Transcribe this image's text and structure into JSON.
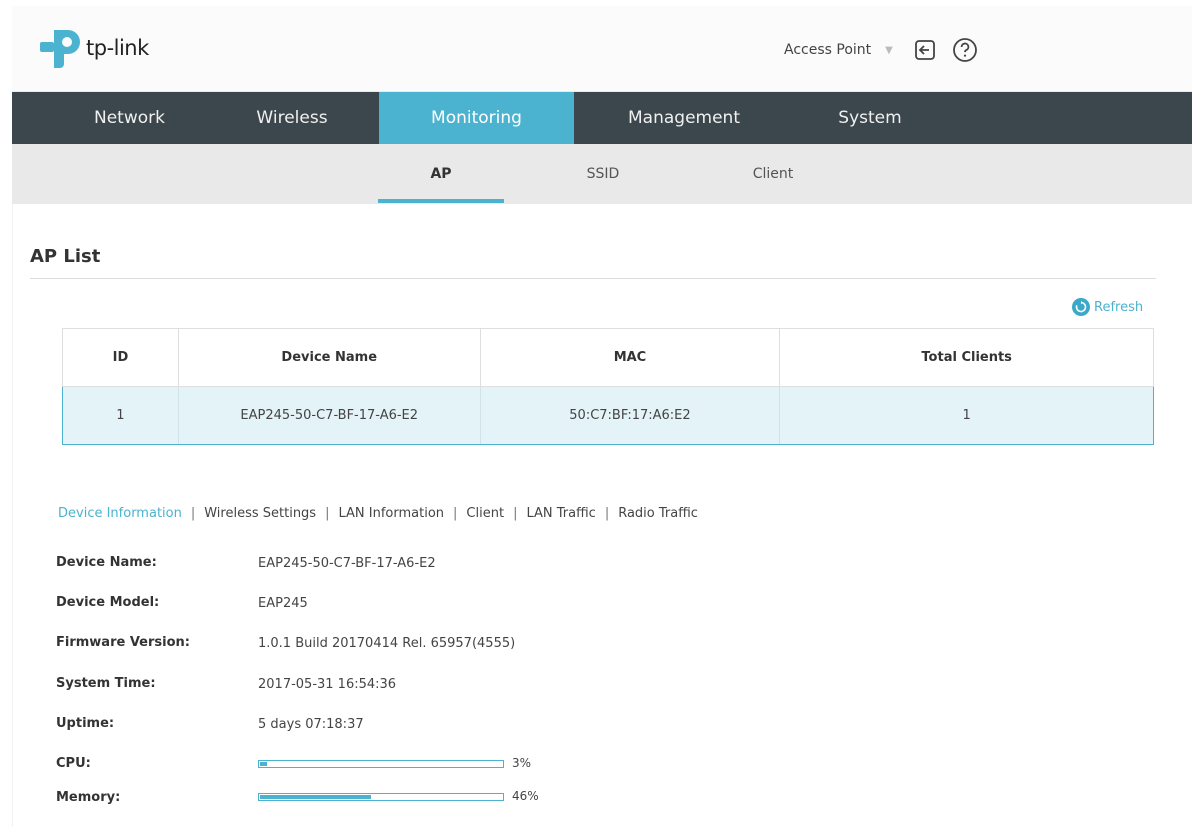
{
  "brand": {
    "name": "tp-link",
    "primary": "#4bb3cf",
    "nav_bg": "#3b474d"
  },
  "header": {
    "mode": "Access Point",
    "logout_icon": "logout-icon",
    "help_icon": "help-icon"
  },
  "main_nav": [
    {
      "label": "Network",
      "active": false
    },
    {
      "label": "Wireless",
      "active": false
    },
    {
      "label": "Monitoring",
      "active": true
    },
    {
      "label": "Management",
      "active": false
    },
    {
      "label": "System",
      "active": false
    }
  ],
  "sub_nav": [
    {
      "label": "AP",
      "active": true
    },
    {
      "label": "SSID",
      "active": false
    },
    {
      "label": "Client",
      "active": false
    }
  ],
  "section": {
    "title": "AP List",
    "refresh_label": "Refresh"
  },
  "table": {
    "columns": [
      "ID",
      "Device Name",
      "MAC",
      "Total Clients"
    ],
    "rows": [
      [
        "1",
        "EAP245-50-C7-BF-17-A6-E2",
        "50:C7:BF:17:A6:E2",
        "1"
      ]
    ]
  },
  "info_tabs": [
    {
      "label": "Device Information",
      "active": true
    },
    {
      "label": "Wireless Settings",
      "active": false
    },
    {
      "label": "LAN Information",
      "active": false
    },
    {
      "label": "Client",
      "active": false
    },
    {
      "label": "LAN Traffic",
      "active": false
    },
    {
      "label": "Radio Traffic",
      "active": false
    }
  ],
  "info_separator": "|",
  "device_info": {
    "device_name": {
      "label": "Device Name:",
      "value": "EAP245-50-C7-BF-17-A6-E2"
    },
    "device_model": {
      "label": "Device Model:",
      "value": "EAP245"
    },
    "firmware": {
      "label": "Firmware Version:",
      "value": "1.0.1 Build 20170414 Rel. 65957(4555)"
    },
    "system_time": {
      "label": "System Time:",
      "value": "2017-05-31 16:54:36"
    },
    "uptime": {
      "label": "Uptime:",
      "value": "5 days 07:18:37"
    },
    "cpu": {
      "label": "CPU:",
      "percent": 3,
      "text": "3%"
    },
    "memory": {
      "label": "Memory:",
      "percent": 46,
      "text": "46%"
    }
  }
}
